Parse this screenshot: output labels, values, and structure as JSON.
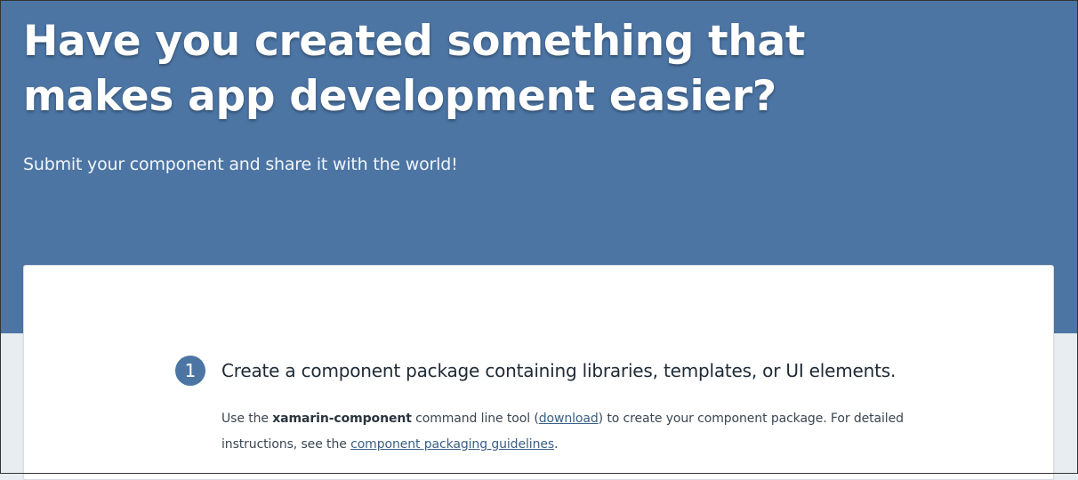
{
  "hero": {
    "title_line1": "Have you created something that",
    "title_line2": "makes app development easier?",
    "subtitle": "Submit your component and share it with the world!"
  },
  "step1": {
    "number": "1",
    "heading": "Create a component package containing libraries, templates, or UI elements.",
    "desc_prefix": "Use the ",
    "tool_name": "xamarin-component",
    "desc_after_tool": " command line tool (",
    "download_link": "download",
    "desc_after_download": ") to create your component package. For detailed instructions, see the ",
    "guidelines_link": "component packaging guidelines",
    "desc_suffix": "."
  },
  "colors": {
    "hero_background": "#4c75a4",
    "page_background": "#e8edf1",
    "card_background": "#ffffff",
    "link": "#3a5f86"
  }
}
